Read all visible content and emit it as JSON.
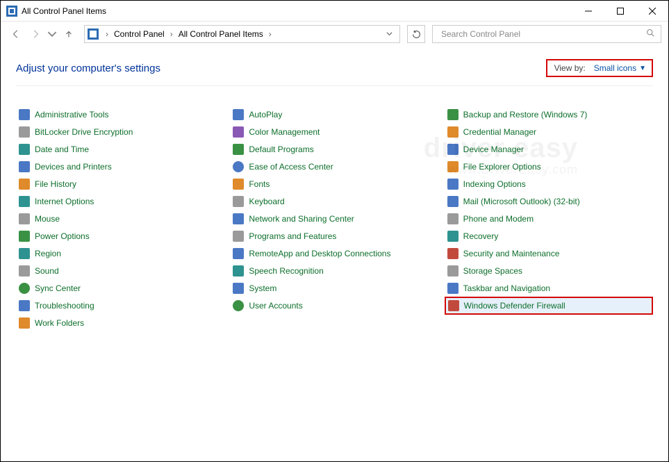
{
  "window": {
    "title": "All Control Panel Items"
  },
  "breadcrumbs": {
    "root": "Control Panel",
    "current": "All Control Panel Items"
  },
  "search": {
    "placeholder": "Search Control Panel"
  },
  "page": {
    "heading": "Adjust your computer's settings"
  },
  "viewby": {
    "label": "View by:",
    "value": "Small icons"
  },
  "watermark": {
    "line1": "driver easy",
    "line2": "www.DriverEasy.com"
  },
  "highlight_item": "Windows Defender Firewall",
  "columns": [
    [
      {
        "label": "Administrative Tools",
        "icon": "admin-tools-icon",
        "cls": "blue"
      },
      {
        "label": "BitLocker Drive Encryption",
        "icon": "bitlocker-icon",
        "cls": "grey"
      },
      {
        "label": "Date and Time",
        "icon": "date-time-icon",
        "cls": "teal"
      },
      {
        "label": "Devices and Printers",
        "icon": "devices-printers-icon",
        "cls": "blue"
      },
      {
        "label": "File History",
        "icon": "file-history-icon",
        "cls": "orange"
      },
      {
        "label": "Internet Options",
        "icon": "internet-options-icon",
        "cls": "teal"
      },
      {
        "label": "Mouse",
        "icon": "mouse-icon",
        "cls": "grey"
      },
      {
        "label": "Power Options",
        "icon": "power-options-icon",
        "cls": "green"
      },
      {
        "label": "Region",
        "icon": "region-icon",
        "cls": "teal"
      },
      {
        "label": "Sound",
        "icon": "sound-icon",
        "cls": "grey"
      },
      {
        "label": "Sync Center",
        "icon": "sync-center-icon",
        "cls": "green round"
      },
      {
        "label": "Troubleshooting",
        "icon": "troubleshooting-icon",
        "cls": "blue"
      },
      {
        "label": "Work Folders",
        "icon": "work-folders-icon",
        "cls": "orange"
      }
    ],
    [
      {
        "label": "AutoPlay",
        "icon": "autoplay-icon",
        "cls": "blue"
      },
      {
        "label": "Color Management",
        "icon": "color-management-icon",
        "cls": "purple"
      },
      {
        "label": "Default Programs",
        "icon": "default-programs-icon",
        "cls": "green"
      },
      {
        "label": "Ease of Access Center",
        "icon": "ease-of-access-icon",
        "cls": "blue round"
      },
      {
        "label": "Fonts",
        "icon": "fonts-icon",
        "cls": "orange"
      },
      {
        "label": "Keyboard",
        "icon": "keyboard-icon",
        "cls": "grey"
      },
      {
        "label": "Network and Sharing Center",
        "icon": "network-sharing-icon",
        "cls": "blue"
      },
      {
        "label": "Programs and Features",
        "icon": "programs-features-icon",
        "cls": "grey"
      },
      {
        "label": "RemoteApp and Desktop Connections",
        "icon": "remoteapp-icon",
        "cls": "blue"
      },
      {
        "label": "Speech Recognition",
        "icon": "speech-recognition-icon",
        "cls": "teal"
      },
      {
        "label": "System",
        "icon": "system-icon",
        "cls": "blue"
      },
      {
        "label": "User Accounts",
        "icon": "user-accounts-icon",
        "cls": "green round"
      }
    ],
    [
      {
        "label": "Backup and Restore (Windows 7)",
        "icon": "backup-restore-icon",
        "cls": "green"
      },
      {
        "label": "Credential Manager",
        "icon": "credential-manager-icon",
        "cls": "orange"
      },
      {
        "label": "Device Manager",
        "icon": "device-manager-icon",
        "cls": "blue"
      },
      {
        "label": "File Explorer Options",
        "icon": "file-explorer-options-icon",
        "cls": "orange"
      },
      {
        "label": "Indexing Options",
        "icon": "indexing-options-icon",
        "cls": "blue"
      },
      {
        "label": "Mail (Microsoft Outlook) (32-bit)",
        "icon": "mail-icon",
        "cls": "blue"
      },
      {
        "label": "Phone and Modem",
        "icon": "phone-modem-icon",
        "cls": "grey"
      },
      {
        "label": "Recovery",
        "icon": "recovery-icon",
        "cls": "teal"
      },
      {
        "label": "Security and Maintenance",
        "icon": "security-maintenance-icon",
        "cls": "red"
      },
      {
        "label": "Storage Spaces",
        "icon": "storage-spaces-icon",
        "cls": "grey"
      },
      {
        "label": "Taskbar and Navigation",
        "icon": "taskbar-navigation-icon",
        "cls": "blue"
      },
      {
        "label": "Windows Defender Firewall",
        "icon": "windows-firewall-icon",
        "cls": "red"
      }
    ]
  ]
}
